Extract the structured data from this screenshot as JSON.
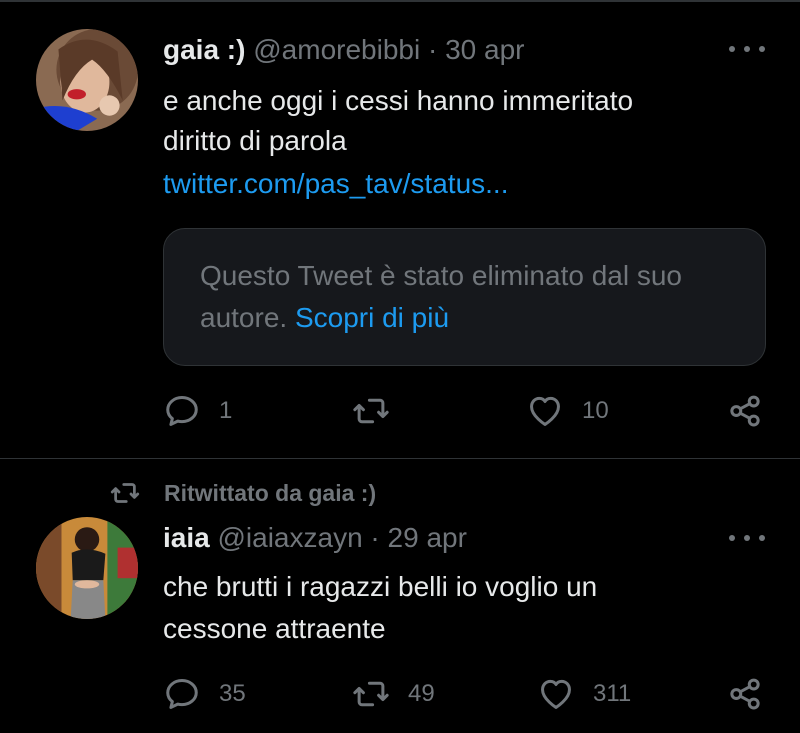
{
  "colors": {
    "background": "#000000",
    "text": "#e7e9ea",
    "muted": "#71767b",
    "link": "#1d9bf0",
    "border": "#2f3336"
  },
  "tweets": [
    {
      "author_name": "gaia :)",
      "handle": "@amorebibbi",
      "separator": "·",
      "date": "30 apr",
      "text_lines": [
        "e anche oggi i cessi hanno immeritato",
        "diritto di parola"
      ],
      "link": "twitter.com/pas_tav/status...",
      "quote": {
        "text": "Questo Tweet è stato eliminato dal suo autore.",
        "learn_more": "Scopri di più"
      },
      "actions": {
        "reply_count": "1",
        "retweet_count": "",
        "like_count": "10"
      },
      "icons": [
        "avatar",
        "more-icon",
        "reply-icon",
        "retweet-icon",
        "like-icon",
        "share-icon"
      ]
    },
    {
      "retweeted_by": "Ritwittato da gaia :)",
      "author_name": "iaia",
      "handle": "@iaiaxzayn",
      "separator": "·",
      "date": "29 apr",
      "text_lines": [
        "che brutti i ragazzi belli io voglio un",
        "cessone attraente"
      ],
      "actions": {
        "reply_count": "35",
        "retweet_count": "49",
        "like_count": "311"
      },
      "icons": [
        "retweet-icon",
        "avatar",
        "more-icon",
        "reply-icon",
        "retweet-icon",
        "like-icon",
        "share-icon"
      ]
    }
  ]
}
